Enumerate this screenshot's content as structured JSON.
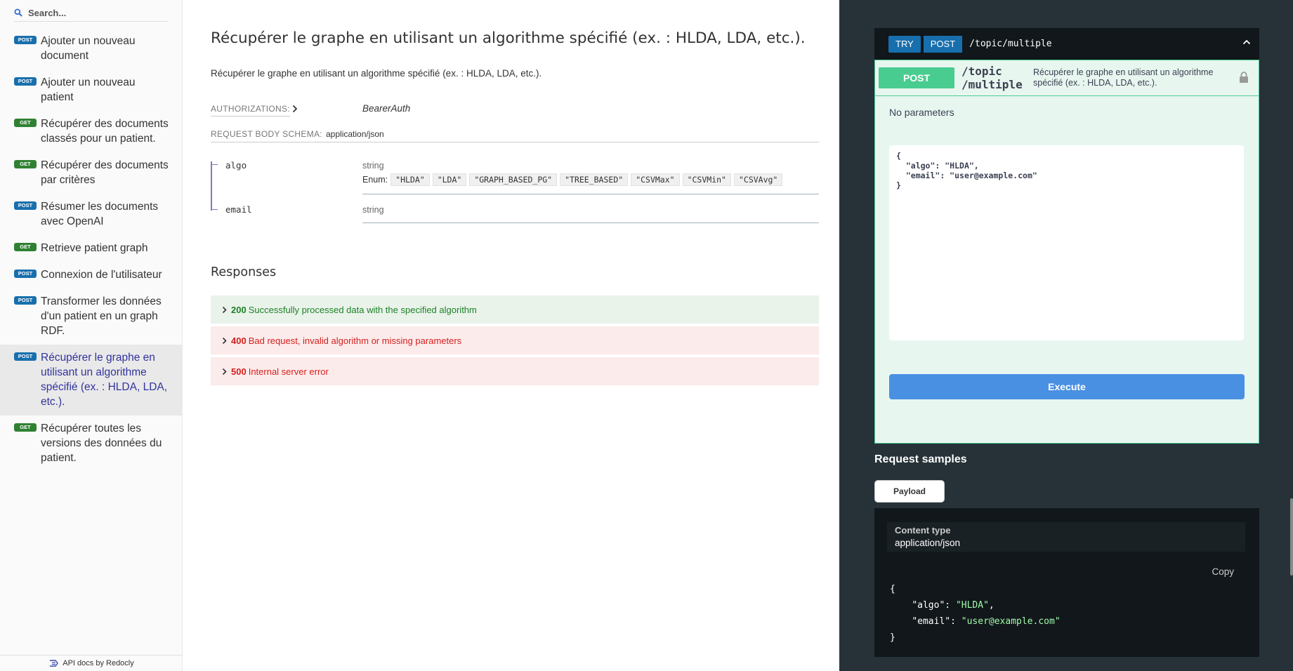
{
  "sidebar": {
    "search_placeholder": "Search...",
    "items": [
      {
        "method": "POST",
        "label": "Ajouter un nouveau document"
      },
      {
        "method": "POST",
        "label": "Ajouter un nouveau patient"
      },
      {
        "method": "GET",
        "label": "Récupérer des documents classés pour un patient."
      },
      {
        "method": "GET",
        "label": "Récupérer des documents par critères"
      },
      {
        "method": "POST",
        "label": "Résumer les documents avec OpenAI"
      },
      {
        "method": "GET",
        "label": "Retrieve patient graph"
      },
      {
        "method": "POST",
        "label": "Connexion de l'utilisateur"
      },
      {
        "method": "POST",
        "label": "Transformer les données d'un patient en un graph RDF."
      },
      {
        "method": "POST",
        "label": "Récupérer le graphe en utilisant un algorithme spécifié (ex. : HLDA, LDA, etc.).",
        "active": true
      },
      {
        "method": "GET",
        "label": "Récupérer toutes les versions des données du patient."
      }
    ],
    "footer": "API docs by Redocly"
  },
  "main": {
    "title": "Récupérer le graphe en utilisant un algorithme spécifié (ex. : HLDA, LDA, etc.).",
    "description": "Récupérer le graphe en utilisant un algorithme spécifié (ex. : HLDA, LDA, etc.).",
    "authorizations_label": "AUTHORIZATIONS:",
    "authorizations_value": "BearerAuth",
    "request_body_label": "REQUEST BODY SCHEMA:",
    "request_body_value": "application/json",
    "properties": [
      {
        "name": "algo",
        "type": "string"
      },
      {
        "name": "email",
        "type": "string"
      }
    ],
    "enum_label": "Enum:",
    "enum_values": [
      "\"HLDA\"",
      "\"LDA\"",
      "\"GRAPH_BASED_PG\"",
      "\"TREE_BASED\"",
      "\"CSVMax\"",
      "\"CSVMin\"",
      "\"CSVAvg\""
    ],
    "responses_title": "Responses",
    "responses": [
      {
        "code": "200",
        "text": "Successfully processed data with the specified algorithm"
      },
      {
        "code": "400",
        "text": "Bad request, invalid algorithm or missing parameters"
      },
      {
        "code": "500",
        "text": "Internal server error"
      }
    ]
  },
  "console": {
    "try_label": "TRY",
    "method": "POST",
    "path": "/topic/multiple",
    "op_method": "POST",
    "op_path": "/topic\n/multiple",
    "op_description": "Récupérer le graphe en utilisant un algorithme spécifié (ex. : HLDA, LDA, etc.).",
    "no_params": "No parameters",
    "body": "{\n  \"algo\": \"HLDA\",\n  \"email\": \"user@example.com\"\n}",
    "execute_label": "Execute"
  },
  "samples": {
    "title": "Request samples",
    "tab_label": "Payload",
    "content_type_label": "Content type",
    "content_type_value": "application/json",
    "copy_label": "Copy",
    "code": {
      "open": "{",
      "k1": "\"algo\"",
      "v1": "\"HLDA\"",
      "k2": "\"email\"",
      "v2": "\"user@example.com\"",
      "close": "}"
    }
  },
  "colors": {
    "post": "#186fad",
    "get": "#2f8132",
    "accent": "#32329f",
    "success": "#1d8127",
    "error": "#d41f1c",
    "panel": "#263238",
    "execute": "#4990e2"
  }
}
